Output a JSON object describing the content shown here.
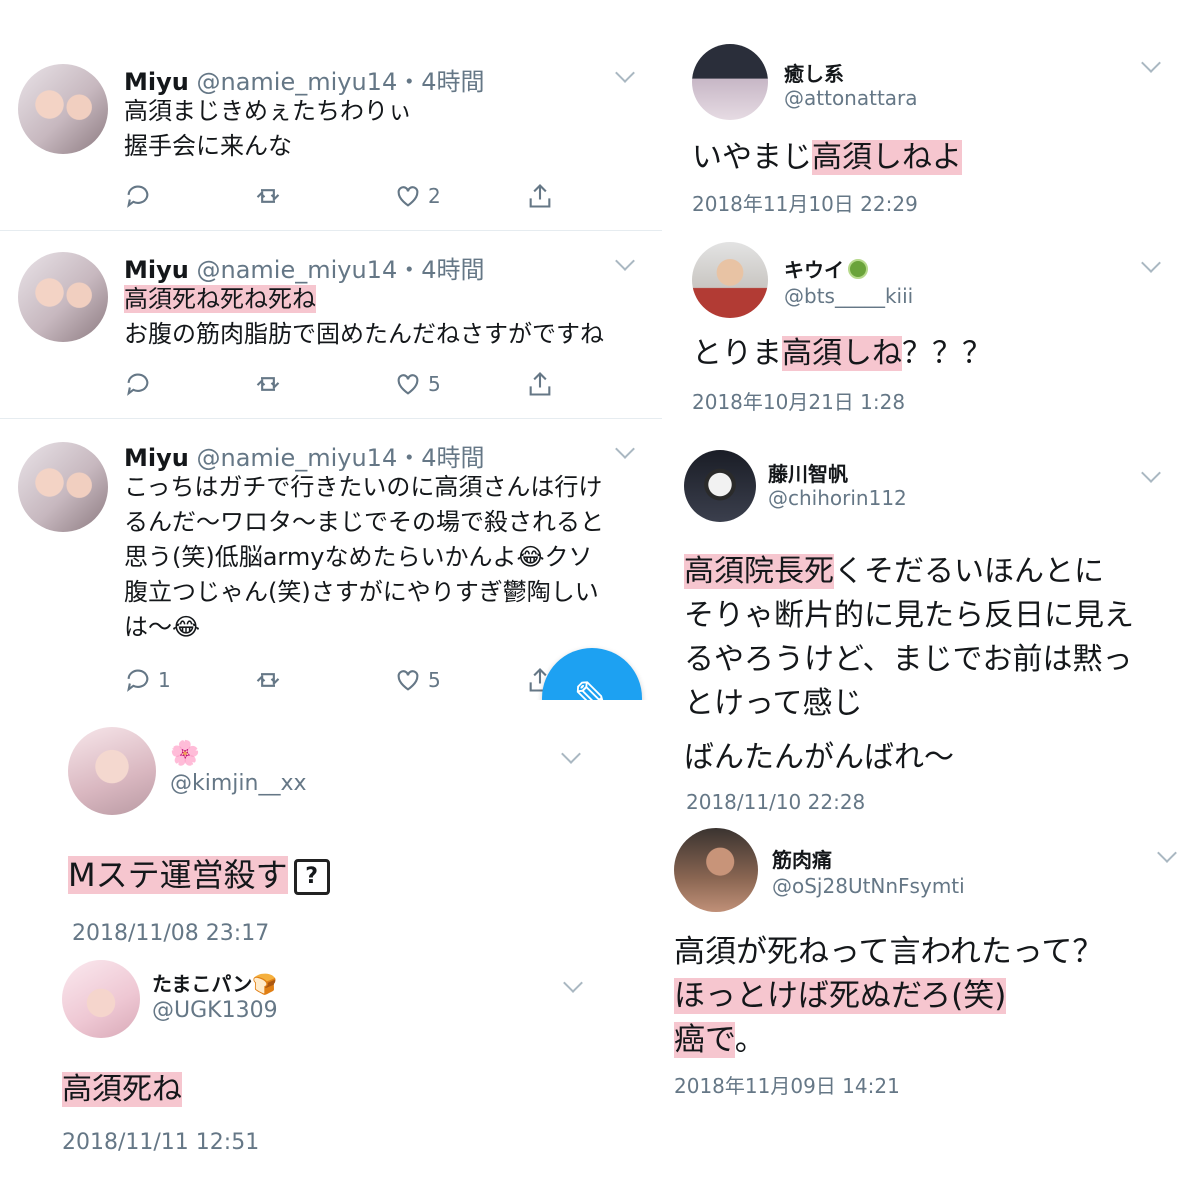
{
  "left_tweets": [
    {
      "name": "Miyu",
      "handle": "@namie_miyu14",
      "time": "・4時間",
      "lines": [
        {
          "text": "高須まじきめぇたちわりぃ",
          "hl": false
        },
        {
          "text": "握手会に来んな",
          "hl": false
        }
      ],
      "reply_count": "",
      "like_count": "2"
    },
    {
      "name": "Miyu",
      "handle": "@namie_miyu14",
      "time": "・4時間",
      "lines": [
        {
          "text": "高須死ね死ね死ね",
          "hl": true
        },
        {
          "text": "お腹の筋肉脂肪で固めたんだねさすがですね",
          "hl": false
        }
      ],
      "reply_count": "",
      "like_count": "5"
    },
    {
      "name": "Miyu",
      "handle": "@namie_miyu14",
      "time": "・4時間",
      "lines": [
        {
          "text": "こっちはガチで行きたいのに高須さんは行け",
          "hl": false
        },
        {
          "text": "るんだ〜ワロタ〜まじでその場で殺されると",
          "hl": false
        },
        {
          "text": "思う(笑)低脳armyなめたらいかんよ😂クソ",
          "hl": false
        },
        {
          "text": "腹立つじゃん(笑)さすがにやりすぎ鬱陶しい",
          "hl": false
        },
        {
          "text": "は〜😂",
          "hl": false
        }
      ],
      "reply_count": "1",
      "like_count": "5"
    }
  ],
  "kimjin": {
    "name": "🌸",
    "handle": "@kimjin__xx",
    "text": "Mステ運営殺す",
    "badge": "?",
    "date": "2018/11/08 23:17"
  },
  "tamako": {
    "name": "たまこパン🍞",
    "handle": "@UGK1309",
    "text": "高須死ね",
    "date": "2018/11/11 12:51"
  },
  "iyashi": {
    "name": "癒し系",
    "handle": "@attonattara",
    "pre": "いやまじ",
    "hl": "高須しねよ",
    "post": "",
    "date": "2018年11月10日 22:29"
  },
  "kiwi": {
    "name": "キウイ",
    "handle": "@bts_____kiii",
    "pre": "とりま",
    "hl": "高須しね",
    "post": "？？？",
    "date": "2018年10月21日 1:28"
  },
  "chiho": {
    "name": "藤川智帆",
    "handle": "@chihorin112",
    "hl": "高須院長死",
    "line1": "くそだるいほんとに",
    "line2": "そりゃ断片的に見たら反日に見え",
    "line3": "るやろうけど、まじでお前は黙っ",
    "line4": "とけって感じ",
    "line5": "ばんたんがんばれ〜",
    "date": "2018/11/10 22:28"
  },
  "kinniku": {
    "name": "筋肉痛",
    "handle": "@oSj28UtNnFsymti",
    "line1": "高須が死ねって言われたって？",
    "line2": "ほっとけば死ぬだろ(笑)",
    "line3a": "癌で",
    "line3b": "。",
    "date": "2018年11月09日 14:21"
  },
  "icons": {
    "reply": "reply-icon",
    "retweet": "retweet-icon",
    "like": "heart-icon",
    "share": "share-icon",
    "compose": "compose-icon"
  },
  "colors": {
    "twitter_blue": "#1da1f2",
    "highlight": "#f6c6cf",
    "meta": "#657786"
  }
}
